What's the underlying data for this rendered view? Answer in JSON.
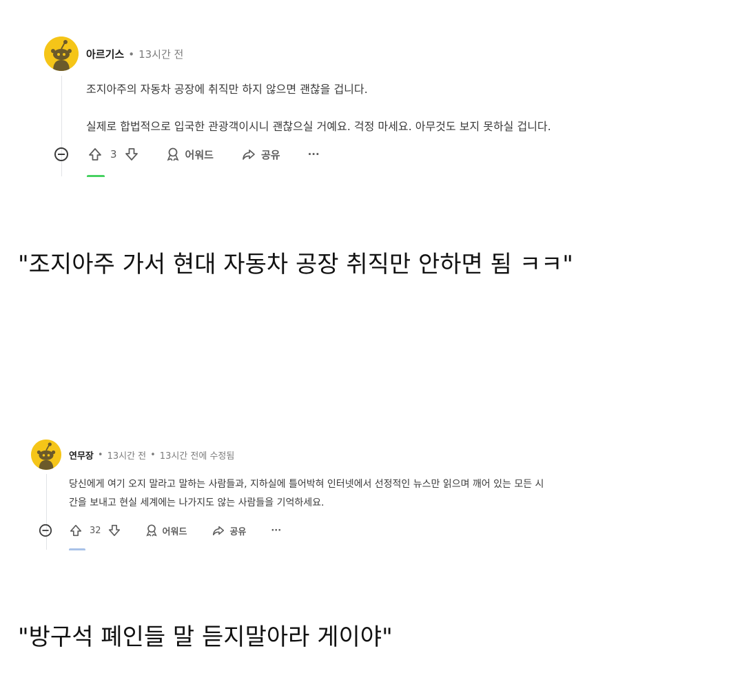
{
  "comment1": {
    "username": "아르기스",
    "time": "13시간 전",
    "paragraphs": [
      "조지아주의 자동차 공장에 취직만 하지 않으면 괜찮을 겁니다.",
      "실제로 합법적으로 입국한 관광객이시니 괜찮으실 거예요. 걱정 마세요. 아무것도 보지 못하실 겁니다."
    ],
    "votes": "3",
    "award_label": "어워드",
    "share_label": "공유",
    "more_label": "···"
  },
  "caption1": "\"조지아주 가서 현대 자동차 공장 취직만 안하면 됨 ㅋㅋ\"",
  "comment2": {
    "username": "연무장",
    "time": "13시간 전",
    "edited": "13시간 전에 수정됨",
    "lines": [
      "당신에게 여기 오지 말라고 말하는 사람들과, 지하실에 틀어박혀 인터넷에서 선정적인 뉴스만 읽으며 깨어 있는 모든 시",
      "간을 보내고 현실 세계에는 나가지도 않는 사람들을 기억하세요."
    ],
    "votes": "32",
    "award_label": "어워드",
    "share_label": "공유",
    "more_label": "···"
  },
  "caption2": "\"방구석 폐인들 말 듣지말아라 게이야\"",
  "colors": {
    "avatar_bg": "#f5c518",
    "meta_gray": "#7c7c7c",
    "action_gray": "#5c5c5c",
    "next_avatar_1": "#46d160",
    "next_avatar_2": "#a8c2e8"
  }
}
